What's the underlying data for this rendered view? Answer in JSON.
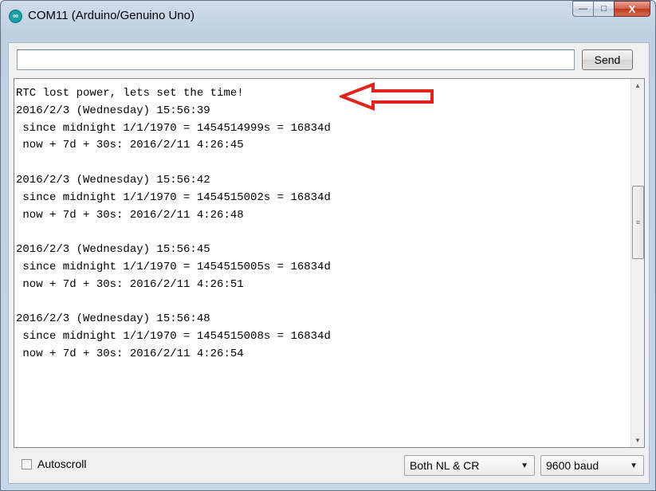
{
  "window": {
    "title": "COM11 (Arduino/Genuino Uno)",
    "app_icon_glyph": "∞",
    "controls": {
      "minimize": "—",
      "maximize": "□",
      "close": "X"
    }
  },
  "toolbar": {
    "input_value": "",
    "send_label": "Send"
  },
  "serial_output": {
    "lines": [
      "RTC lost power, lets set the time!",
      "2016/2/3 (Wednesday) 15:56:39",
      " since midnight 1/1/1970 = 1454514999s = 16834d",
      " now + 7d + 30s: 2016/2/11 4:26:45",
      "",
      "2016/2/3 (Wednesday) 15:56:42",
      " since midnight 1/1/1970 = 1454515002s = 16834d",
      " now + 7d + 30s: 2016/2/11 4:26:48",
      "",
      "2016/2/3 (Wednesday) 15:56:45",
      " since midnight 1/1/1970 = 1454515005s = 16834d",
      " now + 7d + 30s: 2016/2/11 4:26:51",
      "",
      "2016/2/3 (Wednesday) 15:56:48",
      " since midnight 1/1/1970 = 1454515008s = 16834d",
      " now + 7d + 30s: 2016/2/11 4:26:54"
    ],
    "annotation_color": "#e0231c"
  },
  "footer": {
    "autoscroll_label": "Autoscroll",
    "autoscroll_checked": false,
    "line_ending_value": "Both NL & CR",
    "baud_value": "9600 baud"
  },
  "icons": {
    "app": "arduino-icon",
    "scroll_up": "▲",
    "scroll_down": "▼",
    "thumb_grip": "≡",
    "dropdown": "▼"
  }
}
